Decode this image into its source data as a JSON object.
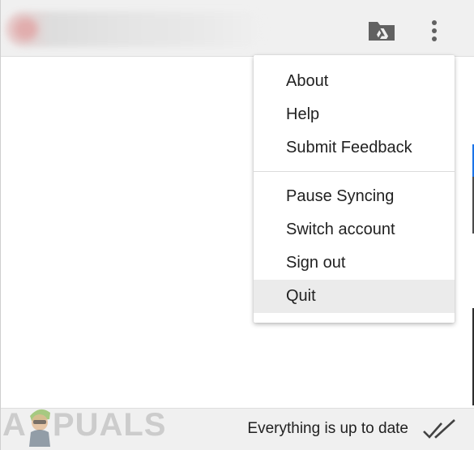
{
  "menu": {
    "items_top": [
      {
        "label": "About"
      },
      {
        "label": "Help"
      },
      {
        "label": "Submit Feedback"
      }
    ],
    "items_bottom": [
      {
        "label": "Pause Syncing"
      },
      {
        "label": "Switch account"
      },
      {
        "label": "Sign out"
      },
      {
        "label": "Quit",
        "active": true
      }
    ]
  },
  "header": {
    "folder_icon": "drive-folder-icon",
    "more_icon": "more-vertical-icon"
  },
  "status": {
    "text": "Everything is up to date",
    "icon": "double-check-icon"
  },
  "watermark": {
    "brand": "APPUALS",
    "text_left": "A",
    "text_right": "PUALS"
  },
  "colors": {
    "header_bg": "#f0f0f0",
    "menu_text": "#212121",
    "hover_bg": "#ebebeb",
    "icon_gray": "#616161",
    "accent_blue": "#1a73e8"
  }
}
